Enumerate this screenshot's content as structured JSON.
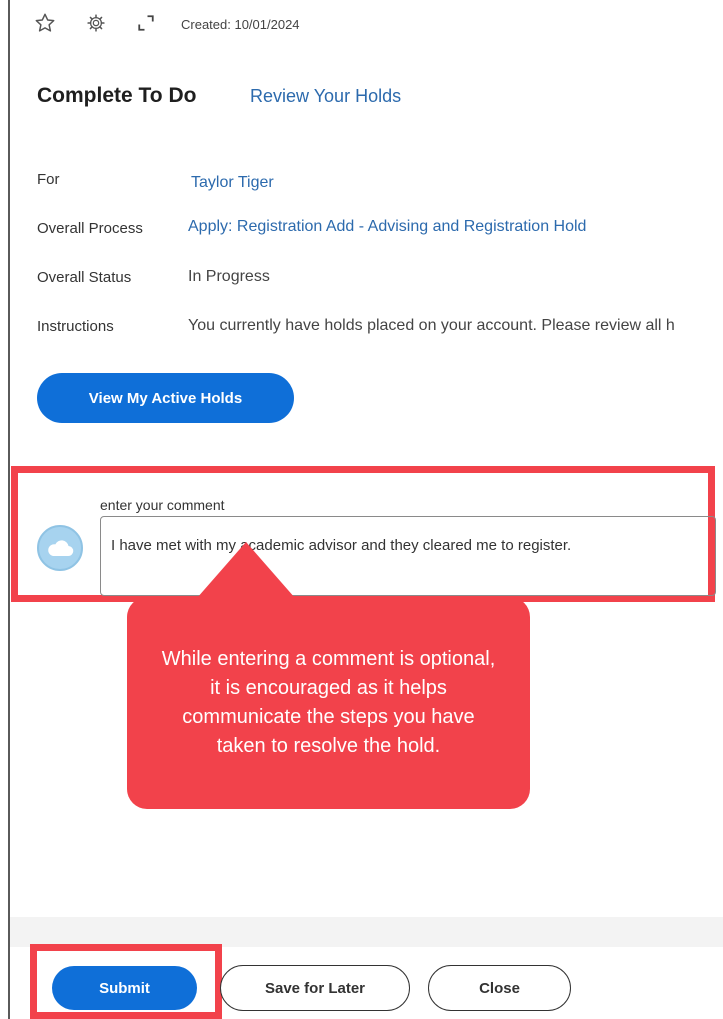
{
  "toolbar": {
    "icons": [
      "star-icon",
      "gear-icon",
      "expand-icon"
    ],
    "created_text": "Created: 10/01/2024"
  },
  "header": {
    "title": "Complete To Do",
    "subtitle_link": "Review Your Holds"
  },
  "details": [
    {
      "label": "For",
      "value": "Taylor Tiger"
    },
    {
      "label": "Overall Process",
      "value": "Apply: Registration Add - Advising and Registration Hold"
    },
    {
      "label": "Overall Status",
      "value": "In Progress"
    },
    {
      "label": "Instructions",
      "value": "You currently have holds placed on your account. Please review all h"
    }
  ],
  "actions": {
    "view_holds_label": "View My Active Holds"
  },
  "comment": {
    "label": "enter your comment",
    "value": "I have met with my academic advisor and they cleared me to register."
  },
  "callout": {
    "text": "While entering a comment is optional, it is encouraged as it helps communicate the steps you have taken to resolve the hold."
  },
  "footer": {
    "submit_label": "Submit",
    "save_label": "Save for Later",
    "close_label": "Close"
  },
  "colors": {
    "accent_blue": "#0f6fd8",
    "link_blue": "#2c6aad",
    "highlight_red": "#f2424b"
  }
}
